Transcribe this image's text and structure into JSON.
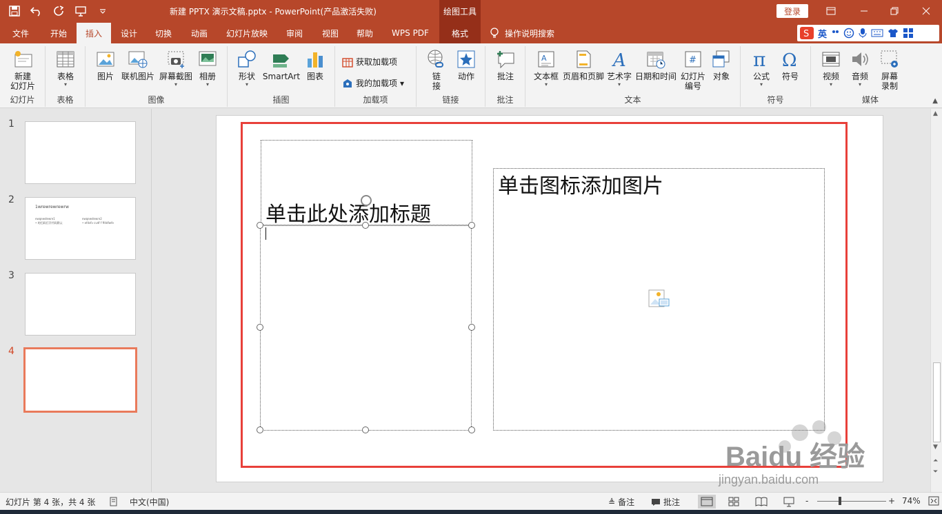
{
  "window": {
    "doc_title": "新建 PPTX 演示文稿.pptx  -  PowerPoint(产品激活失败)",
    "context_tab_group": "绘图工具",
    "login_label": "登录"
  },
  "tabs": [
    {
      "label": "文件"
    },
    {
      "label": "开始"
    },
    {
      "label": "插入"
    },
    {
      "label": "设计"
    },
    {
      "label": "切换"
    },
    {
      "label": "动画"
    },
    {
      "label": "幻灯片放映"
    },
    {
      "label": "审阅"
    },
    {
      "label": "视图"
    },
    {
      "label": "帮助"
    },
    {
      "label": "WPS PDF"
    },
    {
      "label": "格式"
    }
  ],
  "search_hint": "操作说明搜索",
  "ime": {
    "mode": "英"
  },
  "ribbon": {
    "slides": {
      "new_slide_l1": "新建",
      "new_slide_l2": "幻灯片",
      "group": "幻灯片"
    },
    "tables": {
      "table": "表格",
      "group": "表格"
    },
    "images": {
      "picture": "图片",
      "online_picture": "联机图片",
      "screenshot": "屏幕截图",
      "album": "相册",
      "group": "图像"
    },
    "illustrations": {
      "shapes": "形状",
      "smartart": "SmartArt",
      "chart": "图表",
      "group": "插图"
    },
    "addins": {
      "get": "获取加载项",
      "my": "我的加载项",
      "group": "加载项"
    },
    "links": {
      "link_l1": "链",
      "link_l2": "接",
      "action": "动作",
      "group": "链接"
    },
    "comments": {
      "comment": "批注",
      "group": "批注"
    },
    "text": {
      "textbox": "文本框",
      "header_footer": "页眉和页脚",
      "wordart": "艺术字",
      "datetime": "日期和时间",
      "slide_number_l1": "幻灯片",
      "slide_number_l2": "编号",
      "object": "对象",
      "group": "文本"
    },
    "symbols": {
      "equation": "公式",
      "symbol": "符号",
      "group": "符号"
    },
    "media": {
      "video": "视频",
      "audio": "音频",
      "screen_rec_l1": "屏幕",
      "screen_rec_l2": "录制",
      "group": "媒体"
    }
  },
  "thumbnails": [
    {
      "number": "1"
    },
    {
      "number": "2",
      "title": "1wrewrewrewrw",
      "left_head": "ewqewdewre1",
      "left_line": "• 的扫码打开代码默认",
      "right_head": "ewqewdewre2",
      "right_line": "• efdsfv cvdf f ffddfwfe"
    },
    {
      "number": "3"
    },
    {
      "number": "4"
    }
  ],
  "slide": {
    "title_placeholder": "单击此处添加标题",
    "picture_placeholder": "单击图标添加图片"
  },
  "status": {
    "slide_info": "幻灯片 第 4 张，共 4 张",
    "language": "中文(中国)",
    "notes": "备注",
    "comments": "批注",
    "zoom": "74%",
    "zoom_minus": "-",
    "zoom_plus": "+"
  },
  "watermark": {
    "brand": "Baidu 经验",
    "url": "jingyan.baidu.com"
  },
  "colors": {
    "accent": "#b7472a",
    "selected": "#e97a5b",
    "highlight_box": "#e8403a"
  }
}
